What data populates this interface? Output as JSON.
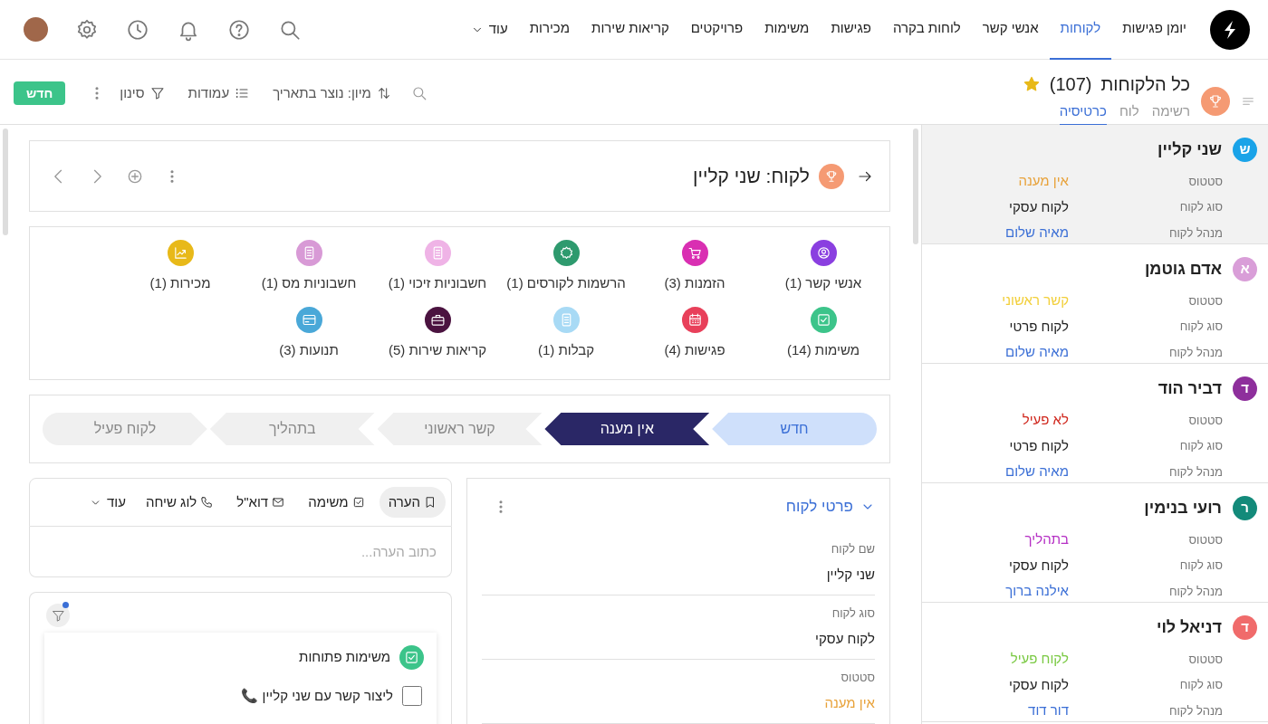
{
  "nav": {
    "items": [
      {
        "label": "יומן פגישות",
        "selected": false
      },
      {
        "label": "לקוחות",
        "selected": true
      },
      {
        "label": "אנשי קשר",
        "selected": false
      },
      {
        "label": "לוחות בקרה",
        "selected": false
      },
      {
        "label": "פגישות",
        "selected": false
      },
      {
        "label": "משימות",
        "selected": false
      },
      {
        "label": "פרויקטים",
        "selected": false
      },
      {
        "label": "קריאות שירות",
        "selected": false
      },
      {
        "label": "מכירות",
        "selected": false
      }
    ],
    "more": "עוד"
  },
  "toolbar": {
    "title": "כל הלקוחות",
    "count": "(107)",
    "starred": true,
    "views": [
      {
        "label": "רשימה",
        "selected": false
      },
      {
        "label": "לוח",
        "selected": false
      },
      {
        "label": "כרטיסיה",
        "selected": true
      }
    ],
    "sort": "מיון: נוצר בתאריך",
    "columns": "עמודות",
    "filter": "סינון",
    "new_button": "חדש"
  },
  "customers": [
    {
      "initial": "ש",
      "color": "#1aa3e8",
      "name": "שני קליין",
      "selected": true,
      "fields": [
        {
          "label": "סטטוס",
          "value": "אין מענה",
          "kind": "status",
          "color": "#e8a23a"
        },
        {
          "label": "סוג לקוח",
          "value": "לקוח עסקי",
          "kind": "text"
        },
        {
          "label": "מנהל לקוח",
          "value": "מאיה שלום",
          "kind": "link"
        }
      ]
    },
    {
      "initial": "א",
      "color": "#d99ed8",
      "name": "אדם גוטמן",
      "selected": false,
      "fields": [
        {
          "label": "סטטוס",
          "value": "קשר ראשוני",
          "kind": "status",
          "color": "#f2cf3a"
        },
        {
          "label": "סוג לקוח",
          "value": "לקוח פרטי",
          "kind": "text"
        },
        {
          "label": "מנהל לקוח",
          "value": "מאיה שלום",
          "kind": "link"
        }
      ]
    },
    {
      "initial": "ד",
      "color": "#8e2f9c",
      "name": "דביר הוד",
      "selected": false,
      "fields": [
        {
          "label": "סטטוס",
          "value": "לא פעיל",
          "kind": "status",
          "color": "#d0271d"
        },
        {
          "label": "סוג לקוח",
          "value": "לקוח פרטי",
          "kind": "text"
        },
        {
          "label": "מנהל לקוח",
          "value": "מאיה שלום",
          "kind": "link"
        }
      ]
    },
    {
      "initial": "ר",
      "color": "#138a7a",
      "name": "רועי בנימין",
      "selected": false,
      "fields": [
        {
          "label": "סטטוס",
          "value": "בתהליך",
          "kind": "status",
          "color": "#b52fc4"
        },
        {
          "label": "סוג לקוח",
          "value": "לקוח עסקי",
          "kind": "text"
        },
        {
          "label": "מנהל לקוח",
          "value": "אילנה ברוך",
          "kind": "link"
        }
      ]
    },
    {
      "initial": "ד",
      "color": "#f06b6b",
      "name": "דניאל לוי",
      "selected": false,
      "fields": [
        {
          "label": "סטטוס",
          "value": "לקוח פעיל",
          "kind": "status",
          "color": "#7ac943"
        },
        {
          "label": "סוג לקוח",
          "value": "לקוח עסקי",
          "kind": "text"
        },
        {
          "label": "מנהל לקוח",
          "value": "דור דוד",
          "kind": "link"
        }
      ]
    }
  ],
  "record": {
    "title": "לקוח: שני קליין",
    "related": [
      {
        "label": "אנשי קשר (1)",
        "kind": "person",
        "color": "#8a3fe0"
      },
      {
        "label": "הזמנות (3)",
        "kind": "cart",
        "color": "#d92fb2"
      },
      {
        "label": "הרשמות לקורסים (1)",
        "kind": "badge",
        "color": "#2e9a6e"
      },
      {
        "label": "חשבוניות זיכוי (1)",
        "kind": "doc",
        "color": "#efb3e6"
      },
      {
        "label": "חשבוניות מס (1)",
        "kind": "doc",
        "color": "#d89ad6"
      },
      {
        "label": "מכירות (1)",
        "kind": "chart",
        "color": "#e8b919"
      },
      {
        "label": "משימות (14)",
        "kind": "check",
        "color": "#3cc48a"
      },
      {
        "label": "פגישות (4)",
        "kind": "calendar",
        "color": "#e8405a"
      },
      {
        "label": "קבלות (1)",
        "kind": "doc",
        "color": "#a8daf5"
      },
      {
        "label": "קריאות שירות (5)",
        "kind": "briefcase",
        "color": "#4b1340"
      },
      {
        "label": "תנועות (3)",
        "kind": "card",
        "color": "#4aa8d8"
      }
    ],
    "stages": [
      {
        "label": "חדש",
        "completed": true,
        "selected": false
      },
      {
        "label": "אין מענה",
        "completed": false,
        "selected": true
      },
      {
        "label": "קשר ראשוני",
        "completed": false,
        "selected": false
      },
      {
        "label": "בתהליך",
        "completed": false,
        "selected": false
      },
      {
        "label": "לקוח פעיל",
        "completed": false,
        "selected": false
      }
    ],
    "details": {
      "title": "פרטי לקוח",
      "expanded": true,
      "fields": [
        {
          "label": "שם לקוח",
          "value": "שני קליין",
          "kind": "text"
        },
        {
          "label": "סוג לקוח",
          "value": "לקוח עסקי",
          "kind": "text"
        },
        {
          "label": "סטטוס",
          "value": "אין מענה",
          "kind": "status",
          "color": "#e8a23a"
        }
      ]
    },
    "activity": {
      "tabs": [
        {
          "label": "הערה",
          "kind": "note",
          "selected": true
        },
        {
          "label": "משימה",
          "kind": "task",
          "selected": false
        },
        {
          "label": "דוא\"ל",
          "kind": "mail",
          "selected": false
        },
        {
          "label": "לוג שיחה",
          "kind": "call",
          "selected": false
        }
      ],
      "more": "עוד",
      "placeholder": "כתוב הערה..."
    },
    "tasks": {
      "filter_active": true,
      "group": "משימות פתוחות",
      "items": [
        {
          "label": "ליצור קשר עם שני קליין 📞",
          "checked": false
        }
      ]
    }
  }
}
